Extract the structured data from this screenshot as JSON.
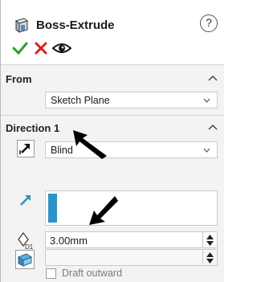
{
  "header": {
    "title": "Boss-Extrude",
    "help_label": "?"
  },
  "actions": {
    "ok_icon": "checkmark-icon",
    "cancel_icon": "x-icon",
    "preview_icon": "eye-icon"
  },
  "from": {
    "title": "From",
    "selected": "Sketch Plane"
  },
  "direction1": {
    "title": "Direction 1",
    "end_condition": "Blind",
    "depth": "3.00mm",
    "depth_icon_label": "D1",
    "draft_label": "Draft outward"
  },
  "colors": {
    "accent": "#2e93c4",
    "ok_green": "#2f9e2f",
    "cancel_red": "#d62020"
  }
}
